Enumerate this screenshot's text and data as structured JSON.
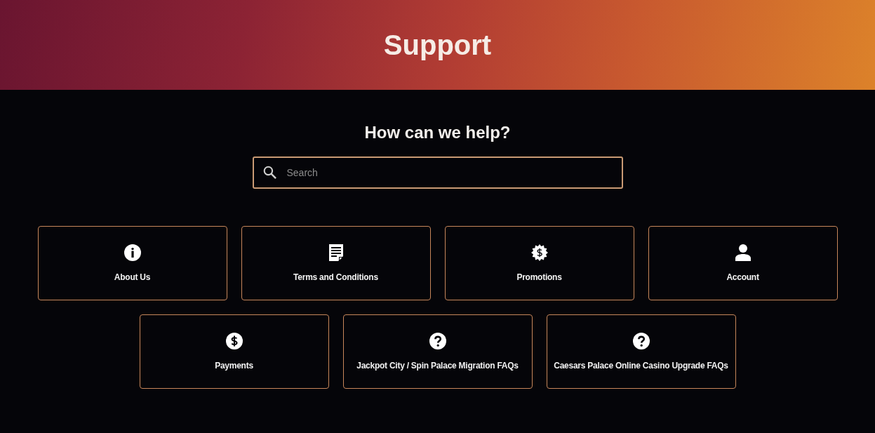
{
  "header": {
    "title": "Support"
  },
  "help": {
    "heading": "How can we help?",
    "search": {
      "placeholder": "Search"
    }
  },
  "categories": [
    {
      "label": "About Us",
      "kind": "info"
    },
    {
      "label": "Terms and Conditions",
      "kind": "document"
    },
    {
      "label": "Promotions",
      "kind": "promo"
    },
    {
      "label": "Account",
      "kind": "person"
    },
    {
      "label": "Payments",
      "kind": "dollar"
    },
    {
      "label": "Jackpot City / Spin Palace Migration FAQs",
      "kind": "question"
    },
    {
      "label": "Caesars Palace Online Casino Upgrade FAQs",
      "kind": "question"
    }
  ]
}
